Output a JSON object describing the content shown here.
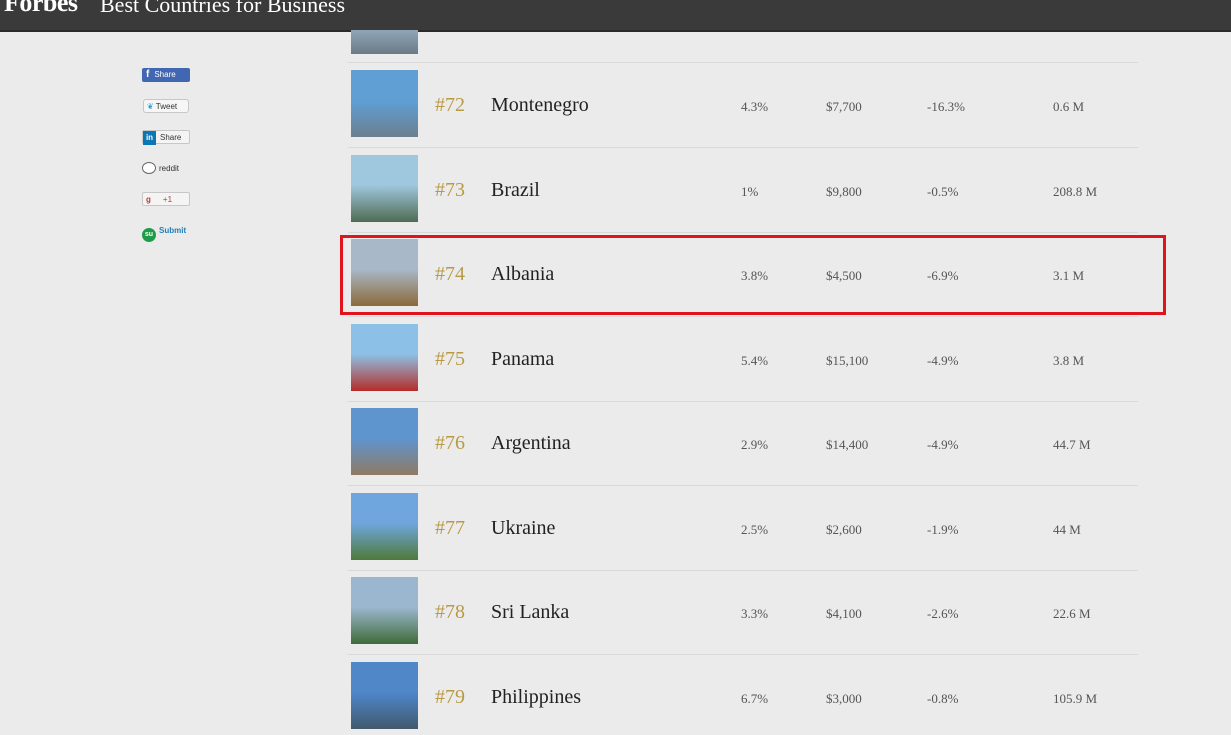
{
  "header": {
    "brand": "Forbes",
    "section_title": "Best Countries for Business"
  },
  "share": {
    "facebook": {
      "icon": "f",
      "label": "Share"
    },
    "twitter": {
      "icon": "❦",
      "label": "Tweet"
    },
    "linkedin": {
      "icon": "in",
      "label": "Share"
    },
    "reddit": {
      "label": "reddit"
    },
    "googleplus": {
      "icon": "g",
      "label": "+1"
    },
    "stumbleupon": {
      "icon": "su",
      "label": "Submit"
    }
  },
  "rows": [
    {
      "rank": "#72",
      "country": "Montenegro",
      "v1": "4.3%",
      "v2": "$7,700",
      "v3": "-16.3%",
      "v4": "0.6 M",
      "sky": "#5f9fd4",
      "ground": "#6b7f8f"
    },
    {
      "rank": "#73",
      "country": "Brazil",
      "v1": "1%",
      "v2": "$9,800",
      "v3": "-0.5%",
      "v4": "208.8 M",
      "sky": "#9fc7dd",
      "ground": "#4f6b53"
    },
    {
      "rank": "#74",
      "country": "Albania",
      "v1": "3.8%",
      "v2": "$4,500",
      "v3": "-6.9%",
      "v4": "3.1 M",
      "sky": "#a9b8c8",
      "ground": "#8a6a3a"
    },
    {
      "rank": "#75",
      "country": "Panama",
      "v1": "5.4%",
      "v2": "$15,100",
      "v3": "-4.9%",
      "v4": "3.8 M",
      "sky": "#8cc0e6",
      "ground": "#b52d28"
    },
    {
      "rank": "#76",
      "country": "Argentina",
      "v1": "2.9%",
      "v2": "$14,400",
      "v3": "-4.9%",
      "v4": "44.7 M",
      "sky": "#5f95cf",
      "ground": "#8e7a63"
    },
    {
      "rank": "#77",
      "country": "Ukraine",
      "v1": "2.5%",
      "v2": "$2,600",
      "v3": "-1.9%",
      "v4": "44 M",
      "sky": "#6fa6dd",
      "ground": "#4f7a3a"
    },
    {
      "rank": "#78",
      "country": "Sri Lanka",
      "v1": "3.3%",
      "v2": "$4,100",
      "v3": "-2.6%",
      "v4": "22.6 M",
      "sky": "#9bb7cf",
      "ground": "#3f6b3a"
    },
    {
      "rank": "#79",
      "country": "Philippines",
      "v1": "6.7%",
      "v2": "$3,000",
      "v3": "-0.8%",
      "v4": "105.9 M",
      "sky": "#4f87c9",
      "ground": "#41596e"
    }
  ],
  "highlight_country": "Albania"
}
